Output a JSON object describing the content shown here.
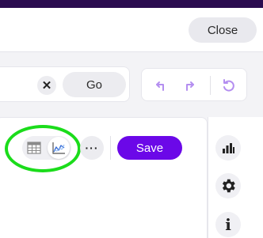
{
  "header": {
    "close_label": "Close"
  },
  "search": {
    "clear_icon": "close-icon",
    "go_label": "Go"
  },
  "history": {
    "undo_icon": "undo-arrow-icon",
    "redo_icon": "redo-arrow-icon",
    "reset_icon": "rotate-ccw-icon",
    "icon_color": "#b48ef0"
  },
  "toolbar": {
    "table_view_icon": "table-icon",
    "chart_view_icon": "line-chart-icon",
    "more_label": "···",
    "save_label": "Save",
    "save_color": "#6b08e8",
    "highlight_color": "#1bdc1b"
  },
  "sidebar": {
    "items": [
      {
        "icon": "bar-chart-icon"
      },
      {
        "icon": "gear-icon"
      },
      {
        "icon": "info-icon",
        "label": "i"
      }
    ]
  }
}
